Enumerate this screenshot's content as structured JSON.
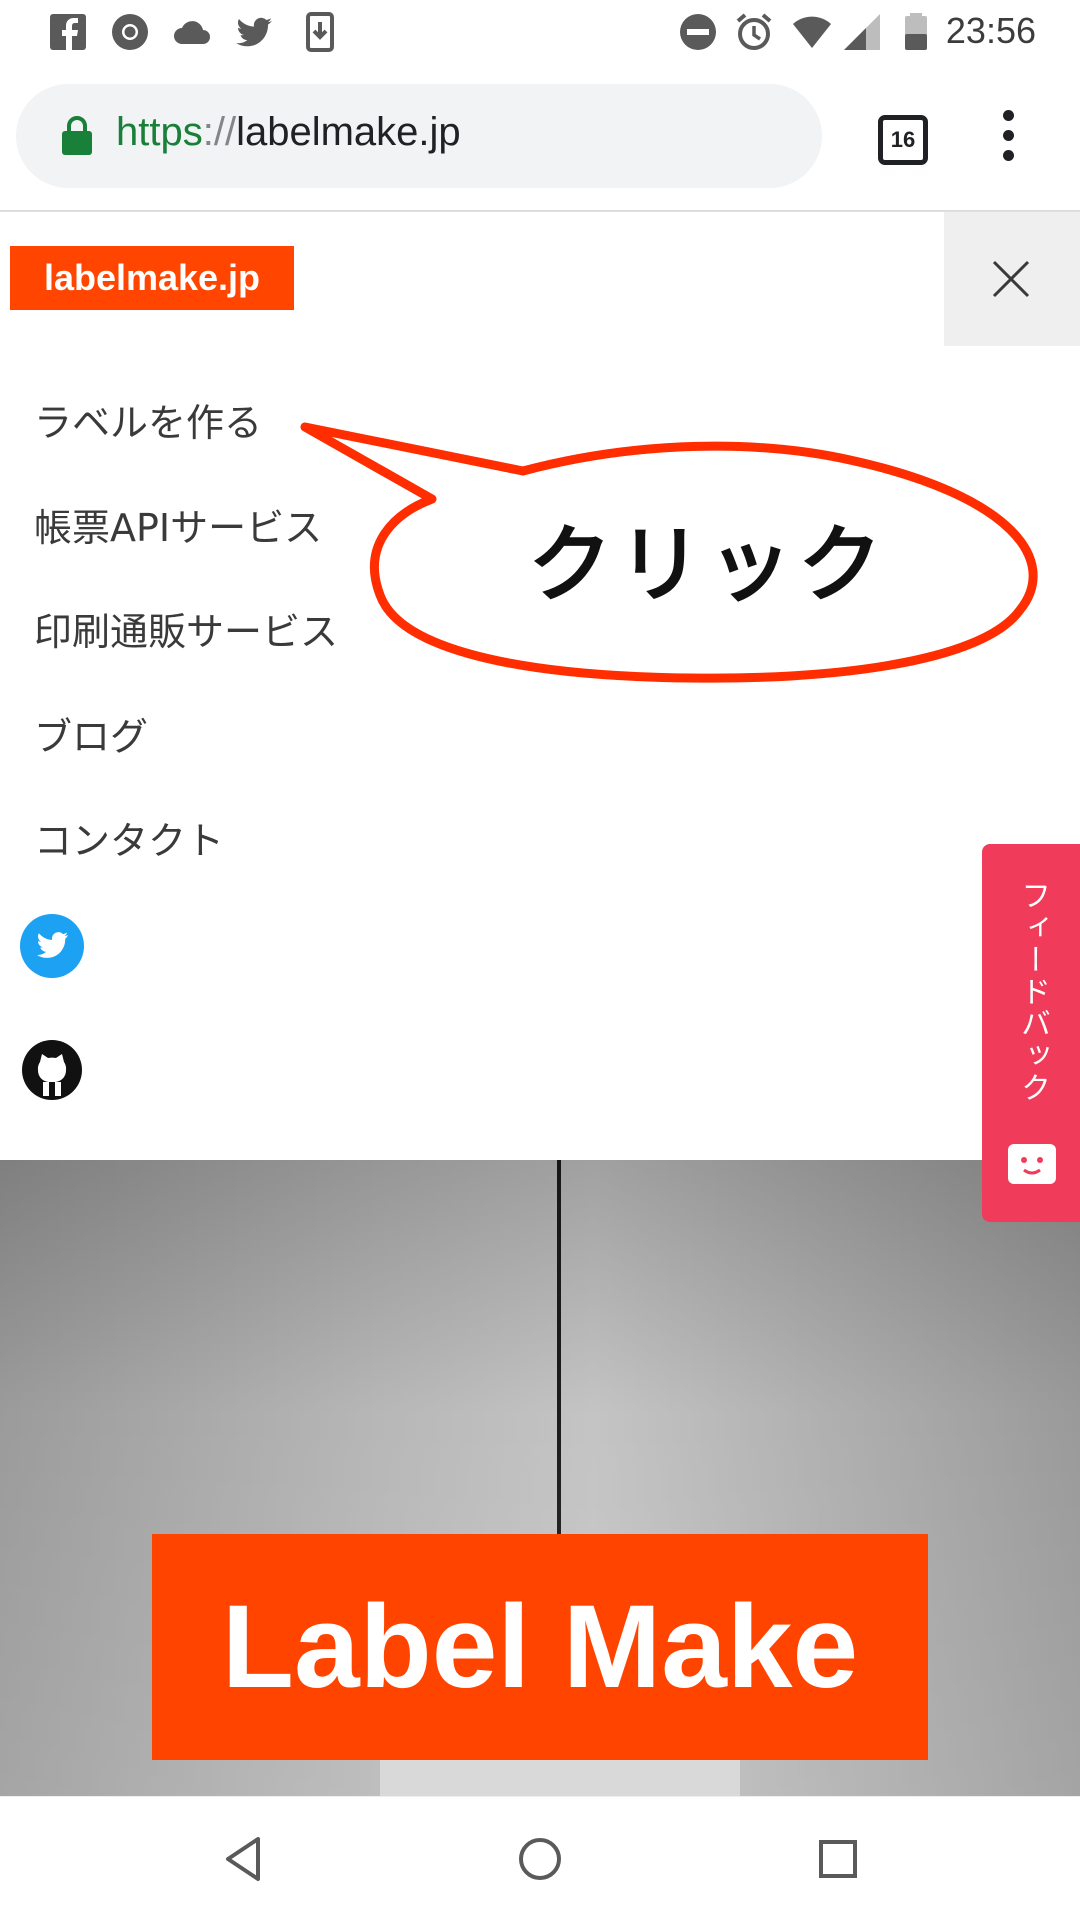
{
  "status_bar": {
    "time": "23:56",
    "left_icons": [
      "facebook-icon",
      "chrome-icon",
      "cloud-icon",
      "twitter-icon",
      "download-icon"
    ],
    "right_icons": [
      "do-not-disturb-icon",
      "alarm-icon",
      "wifi-icon",
      "signal-icon",
      "battery-icon"
    ]
  },
  "browser": {
    "url_scheme": "https",
    "url_separator": "://",
    "url_host": "labelmake.jp",
    "tab_count": "16"
  },
  "site": {
    "logo": "labelmake.jp",
    "nav_items": [
      {
        "label": "ラベルを作る"
      },
      {
        "label": "帳票APIサービス"
      },
      {
        "label": "印刷通販サービス"
      },
      {
        "label": "ブログ"
      },
      {
        "label": "コンタクト"
      }
    ],
    "social": [
      "twitter-icon",
      "github-icon"
    ]
  },
  "callout": {
    "text": "クリック"
  },
  "hero": {
    "title": "Label Make"
  },
  "feedback": {
    "label": "フィードバック"
  },
  "colors": {
    "brand": "#ff4500",
    "feedback": "#f03b5a",
    "callout_border": "#ff2d00",
    "url_scheme": "#188038"
  }
}
